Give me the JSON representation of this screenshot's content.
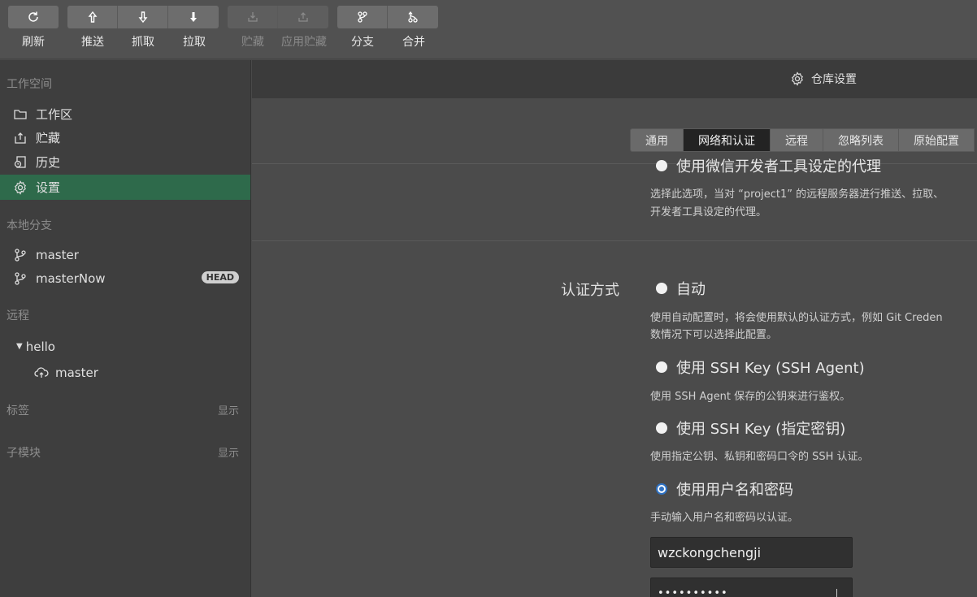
{
  "toolbar": {
    "refresh": "刷新",
    "push": "推送",
    "fetch": "抓取",
    "pull": "拉取",
    "stash": "贮藏",
    "apply_stash": "应用贮藏",
    "branch": "分支",
    "merge": "合并"
  },
  "sidebar": {
    "workspace_title": "工作空间",
    "workspace_items": [
      "工作区",
      "贮藏",
      "历史",
      "设置"
    ],
    "local_title": "本地分支",
    "local_branches": [
      "master",
      "masterNow"
    ],
    "head_badge": "HEAD",
    "remote_title": "远程",
    "remote_name": "hello",
    "remote_branch": "master",
    "tags_title": "标签",
    "tags_show": "显示",
    "submodules_title": "子模块",
    "submodules_show": "显示"
  },
  "main": {
    "title": "仓库设置",
    "tabs": [
      "通用",
      "网络和认证",
      "远程",
      "忽略列表",
      "原始配置"
    ],
    "proxy_option": "使用微信开发者工具设定的代理",
    "proxy_desc_1": "选择此选项，当对 “project1” 的远程服务器进行推送、拉取、",
    "proxy_desc_2": "开发者工具设定的代理。",
    "auth_label": "认证方式",
    "auth_auto": "自动",
    "auth_auto_desc_1": "使用自动配置时，将会使用默认的认证方式，例如 Git Creden",
    "auth_auto_desc_2": "数情况下可以选择此配置。",
    "auth_ssh_agent": "使用 SSH Key (SSH Agent)",
    "auth_ssh_agent_desc": "使用 SSH Agent 保存的公钥来进行鉴权。",
    "auth_ssh_key": "使用 SSH Key (指定密钥)",
    "auth_ssh_key_desc": "使用指定公钥、私钥和密码口令的 SSH 认证。",
    "auth_userpass": "使用用户名和密码",
    "auth_userpass_desc": "手动输入用户名和密码以认证。",
    "username": "wzckongchengji",
    "password": "••••••••••"
  }
}
